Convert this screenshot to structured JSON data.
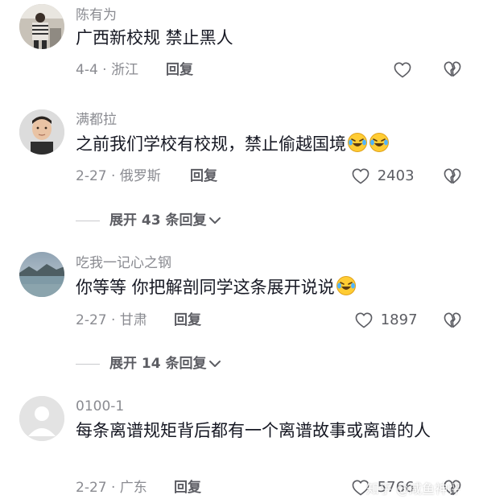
{
  "comments": [
    {
      "username": "陈有为",
      "text": "广西新校规 禁止黑人",
      "date_location": "4-4 · 浙江",
      "reply_label": "回复",
      "like_count": "",
      "avatar": "person-photo-icon"
    },
    {
      "username": "满都拉",
      "text": "之前我们学校有校规，禁止偷越国境",
      "emoji": [
        "laughing-crying-emoji-icon",
        "laughing-crying-emoji-icon"
      ],
      "date_location": "2-27 · 俄罗斯",
      "reply_label": "回复",
      "like_count": "2403",
      "expand_label": "展开 43 条回复",
      "avatar": "man-portrait-icon"
    },
    {
      "username": "吃我一记心之钢",
      "text": "你等等 你把解剖同学这条展开说说",
      "emoji": [
        "laughing-crying-emoji-icon"
      ],
      "date_location": "2-27 · 甘肃",
      "reply_label": "回复",
      "like_count": "1897",
      "expand_label": "展开 14 条回复",
      "avatar": "lake-landscape-icon"
    },
    {
      "username": "0100-1",
      "text": "每条离谱规矩背后都有一个离谱故事或离谱的人",
      "date_location": "2-27 · 广东",
      "reply_label": "回复",
      "like_count": "5766",
      "avatar": "default-user-icon"
    }
  ],
  "watermark": "知乎 @咸鱼神评",
  "colors": {
    "text": "#161823",
    "secondary": "#8a8b91",
    "action": "#5c5d63",
    "background": "#ffffff"
  }
}
